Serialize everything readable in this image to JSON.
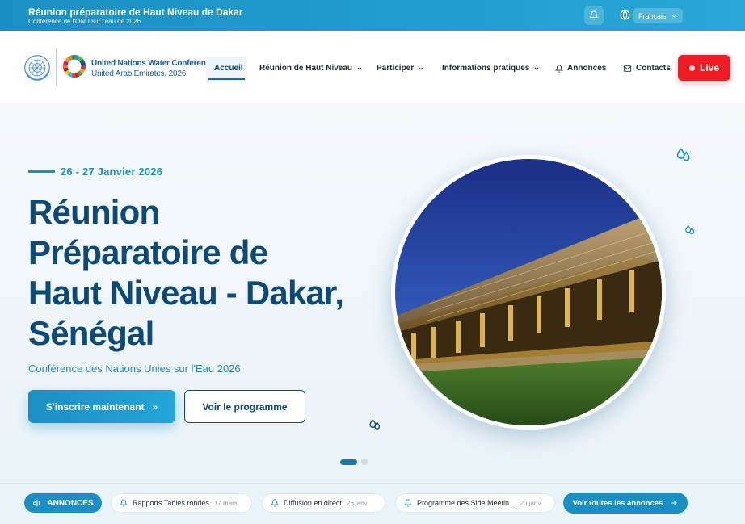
{
  "topbar": {
    "title": "Réunion préparatoire de Haut Niveau de Dakar",
    "subtitle": "Conférence de l'ONU sur l'eau de 2026",
    "language": "Français"
  },
  "header": {
    "conference_name": "United Nations Water Conference",
    "conference_sub": "United Arab Emirates, 2026",
    "nav": [
      {
        "label": "Accueil"
      },
      {
        "label": "Réunion de Haut Niveau"
      },
      {
        "label": "Participer"
      },
      {
        "label": "Informations pratiques"
      },
      {
        "label": "Annonces"
      },
      {
        "label": "Contacts"
      }
    ],
    "live_label": "Live"
  },
  "hero": {
    "date": "26 - 27 Janvier 2026",
    "title_lines": [
      "Réunion",
      "Préparatoire de",
      "Haut Niveau - Dakar,",
      "Sénégal"
    ],
    "subtitle": "Conférence des Nations Unies sur l'Eau 2026",
    "primary_button": "S'inscrire maintenant",
    "primary_arrow": "»",
    "secondary_button": "Voir le programme"
  },
  "announcements": {
    "badge": "ANNONCES",
    "items": [
      {
        "title": "Rapports Tables rondes",
        "date": "17 mars"
      },
      {
        "title": "Diffusion en direct",
        "date": "26 janv."
      },
      {
        "title": "Programme des Side Meetin...",
        "date": "20 janv."
      }
    ],
    "see_all": "Voir toutes les annonces"
  },
  "colors": {
    "primary": "#1a8fc4",
    "navy": "#0d4a78",
    "live": "#ef1c25"
  }
}
